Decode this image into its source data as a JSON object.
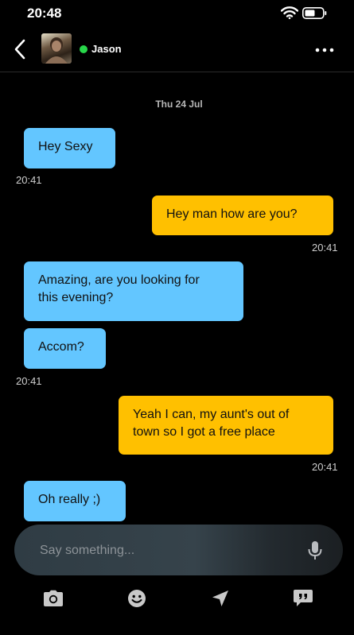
{
  "status": {
    "time": "20:48"
  },
  "header": {
    "contact_name": "Jason"
  },
  "date_separator": "Thu 24 Jul",
  "messages": [
    {
      "direction": "incoming",
      "lines": [
        "Hey Sexy"
      ]
    },
    {
      "direction": "incoming",
      "time": "20:41"
    },
    {
      "direction": "outgoing",
      "lines": [
        "Hey man how are you?"
      ],
      "time": "20:41"
    },
    {
      "direction": "incoming",
      "lines": [
        "Amazing, are you looking for",
        "this evening?"
      ]
    },
    {
      "direction": "incoming",
      "lines": [
        "Accom?"
      ],
      "time": "20:41"
    },
    {
      "direction": "outgoing",
      "lines": [
        "Yeah I can, my aunt's out of",
        "town so I got a free place"
      ],
      "time": "20:41"
    },
    {
      "direction": "incoming",
      "lines": [
        "Oh really ;)"
      ]
    }
  ],
  "composer": {
    "placeholder": "Say something..."
  },
  "toolbar": {
    "icons": [
      "camera-icon",
      "smiley-icon",
      "location-icon",
      "quick-reply-icon"
    ]
  },
  "colors": {
    "incoming_bubble": "#63c6ff",
    "outgoing_bubble": "#ffc000",
    "online": "#28d74a",
    "background": "#000000"
  }
}
